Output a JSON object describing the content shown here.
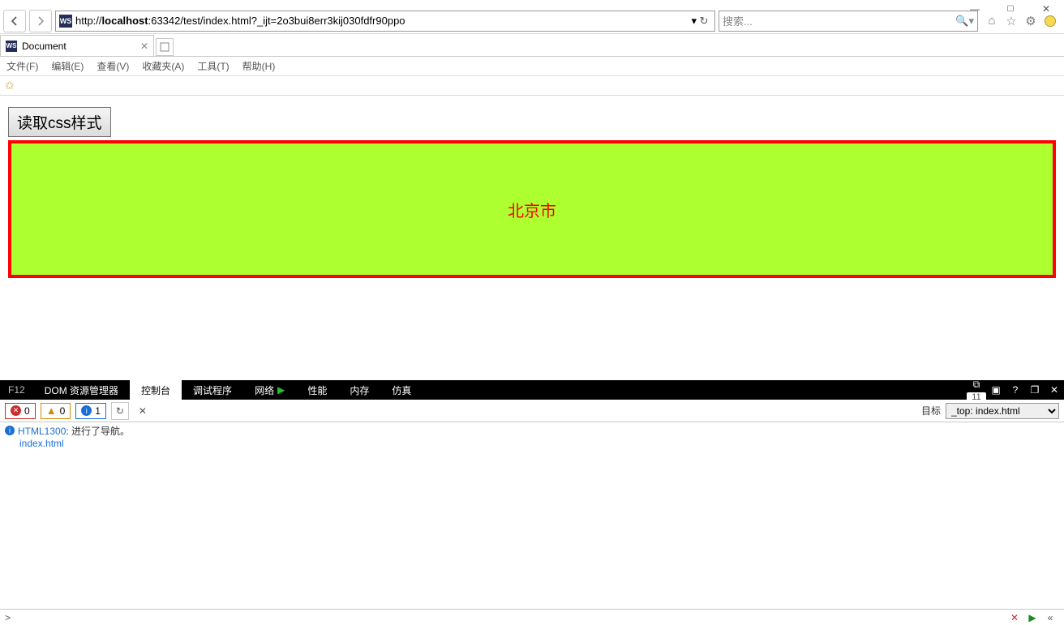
{
  "window": {
    "min": "—",
    "max": "☐",
    "close": "✕"
  },
  "nav": {
    "url_pre": "http://",
    "url_host": "localhost",
    "url_rest": ":63342/test/index.html?_ijt=2o3bui8err3kij030fdfr90ppo",
    "dropdown": "▾",
    "reload": "↻",
    "search_placeholder": "搜索...",
    "favicon": "WS"
  },
  "tab": {
    "title": "Document",
    "favicon": "WS"
  },
  "menus": [
    "文件(F)",
    "编辑(E)",
    "查看(V)",
    "收藏夹(A)",
    "工具(T)",
    "帮助(H)"
  ],
  "page": {
    "button_label": "读取css样式",
    "box_text": "北京市"
  },
  "devtools": {
    "f12": "F12",
    "tabs": [
      "DOM 资源管理器",
      "控制台",
      "调试程序",
      "网络",
      "性能",
      "内存",
      "仿真"
    ],
    "active_index": 1,
    "pin_count": "11",
    "counts": {
      "error": "0",
      "warn": "0",
      "info": "1"
    },
    "target_label": "目标",
    "target_value": "_top: index.html",
    "log_code": "HTML1300",
    "log_msg": "进行了导航。",
    "log_file": "index.html",
    "prompt": ">"
  }
}
